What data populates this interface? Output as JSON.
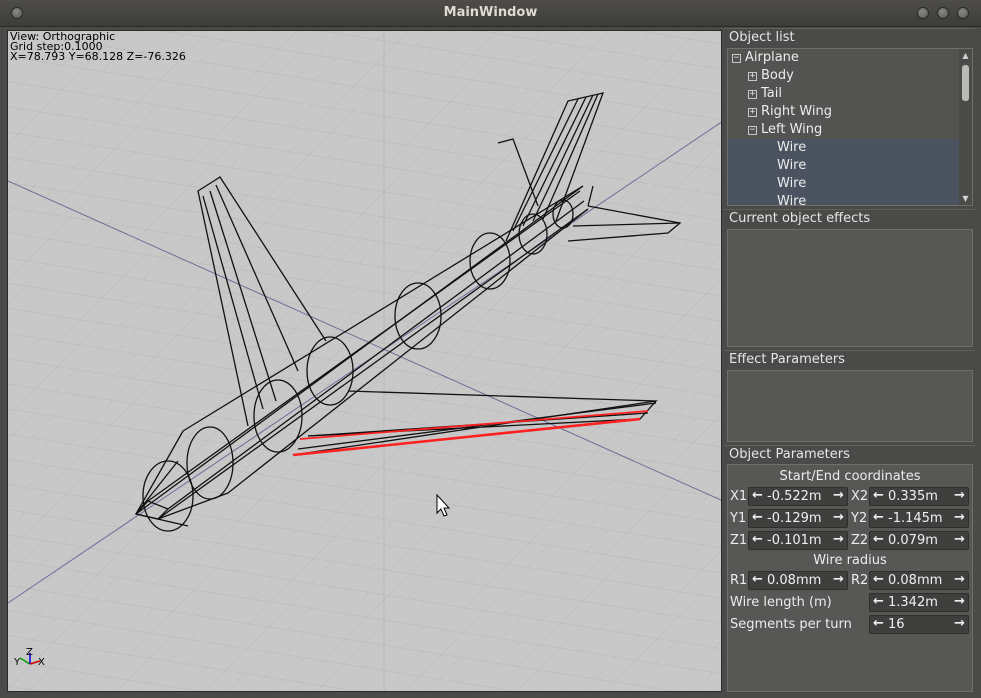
{
  "window": {
    "title": "MainWindow"
  },
  "viewport": {
    "view_label": "View: Orthographic",
    "grid_label": "Grid step:0.1000",
    "coords_label": "X=78.793  Y=68.128  Z=-76.326",
    "axis_labels": {
      "y": "Y",
      "z": "Z",
      "x": "X"
    }
  },
  "object_list": {
    "header": "Object list",
    "items": [
      {
        "label": "Airplane",
        "expander": "−",
        "selected": false
      },
      {
        "label": "Body",
        "expander": "+",
        "selected": false
      },
      {
        "label": "Tail",
        "expander": "+",
        "selected": false
      },
      {
        "label": "Right Wing",
        "expander": "+",
        "selected": false
      },
      {
        "label": "Left Wing",
        "expander": "−",
        "selected": false
      },
      {
        "label": "Wire",
        "expander": "",
        "selected": true
      },
      {
        "label": "Wire",
        "expander": "",
        "selected": true
      },
      {
        "label": "Wire",
        "expander": "",
        "selected": true
      },
      {
        "label": "Wire",
        "expander": "",
        "selected": true
      }
    ]
  },
  "effects": {
    "header": "Current object effects"
  },
  "effect_params": {
    "header": "Effect Parameters"
  },
  "object_params": {
    "header": "Object Parameters",
    "coords_title": "Start/End coordinates",
    "x1_label": "X1",
    "x1": "-0.522m",
    "x2_label": "X2",
    "x2": "0.335m",
    "y1_label": "Y1",
    "y1": "-0.129m",
    "y2_label": "Y2",
    "y2": "-1.145m",
    "z1_label": "Z1",
    "z1": "-0.101m",
    "z2_label": "Z2",
    "z2": "0.079m",
    "radius_title": "Wire radius",
    "r1_label": "R1",
    "r1": "0.08mm",
    "r2_label": "R2",
    "r2": "0.08mm",
    "length_label": "Wire length (m)",
    "length": "1.342m",
    "segments_label": "Segments per turn",
    "segments": "16"
  },
  "colors": {
    "selection_highlight": "#ff2020",
    "wire": "#111111"
  }
}
